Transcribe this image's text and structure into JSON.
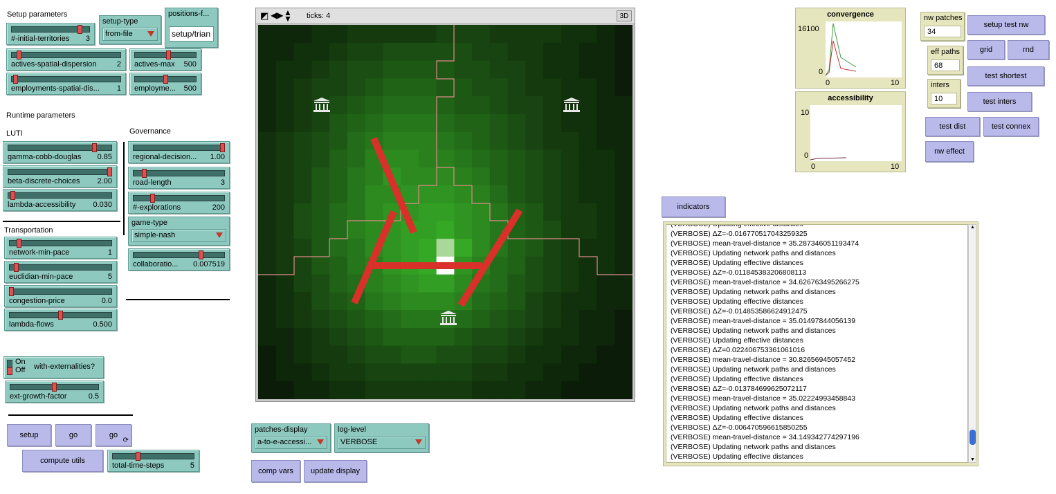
{
  "setup": {
    "section_label": "Setup parameters",
    "initial_territories": {
      "name": "#-initial-territories",
      "value": "3",
      "level": 0.9
    },
    "setup_type": {
      "name": "setup-type",
      "value": "from-file"
    },
    "positions_file": {
      "name": "positions-f...",
      "value": "setup/trian"
    },
    "actives_spatial_dispersion": {
      "name": "actives-spatial-dispersion",
      "value": "2",
      "level": 0.05
    },
    "actives_max": {
      "name": "actives-max",
      "value": "500",
      "level": 0.55
    },
    "employments_spatial_dis": {
      "name": "employments-spatial-dis...",
      "value": "1",
      "level": 0.02
    },
    "employments_max": {
      "name": "employme...",
      "value": "500",
      "level": 0.5
    }
  },
  "runtime": {
    "section_label": "Runtime parameters",
    "luti_label": "LUTI",
    "gamma": {
      "name": "gamma-cobb-douglas",
      "value": "0.85",
      "level": 0.85
    },
    "beta": {
      "name": "beta-discrete-choices",
      "value": "2.00",
      "level": 1.0
    },
    "lambda_access": {
      "name": "lambda-accessibility",
      "value": "0.030",
      "level": 0.03
    },
    "transport_label": "Transportation",
    "network_min_pace": {
      "name": "network-min-pace",
      "value": "1",
      "level": 0.08
    },
    "euclidian_min_pace": {
      "name": "euclidian-min-pace",
      "value": "5",
      "level": 0.05
    },
    "congestion_price": {
      "name": "congestion-price",
      "value": "0.0",
      "level": 0.0
    },
    "lambda_flows": {
      "name": "lambda-flows",
      "value": "0.500",
      "level": 0.5
    },
    "governance_label": "Governance",
    "regional_decision": {
      "name": "regional-decision...",
      "value": "1.00",
      "level": 1.0
    },
    "road_length": {
      "name": "road-length",
      "value": "3",
      "level": 0.1
    },
    "explorations": {
      "name": "#-explorations",
      "value": "200",
      "level": 0.2
    },
    "game_type": {
      "name": "game-type",
      "value": "simple-nash"
    },
    "collaboration": {
      "name": "collaboratio...",
      "value": "0.007519",
      "level": 0.75
    }
  },
  "externalities": {
    "switch_on": "On",
    "switch_off": "Off",
    "switch_name": "with-externalities?",
    "ext_growth": {
      "name": "ext-growth-factor",
      "value": "0.5",
      "level": 0.5
    }
  },
  "controls": {
    "setup": "setup",
    "go_once": "go",
    "go_forever": "go",
    "compute_utils": "compute utils",
    "total_time_steps": {
      "name": "total-time-steps",
      "value": "5",
      "level": 0.3
    }
  },
  "view": {
    "ticks_label": "ticks: 4",
    "three_d": "3D",
    "grid_size": 21,
    "patches": [
      [
        2,
        2,
        2,
        3,
        3,
        4,
        4,
        4,
        4,
        4,
        5,
        5,
        5,
        4,
        4,
        4,
        4,
        3,
        3,
        2,
        1
      ],
      [
        2,
        2,
        3,
        3,
        4,
        5,
        5,
        6,
        6,
        6,
        6,
        6,
        5,
        5,
        4,
        4,
        3,
        3,
        2,
        2,
        1
      ],
      [
        2,
        3,
        3,
        4,
        5,
        6,
        6,
        7,
        7,
        7,
        7,
        6,
        6,
        5,
        5,
        4,
        3,
        3,
        2,
        2,
        1
      ],
      [
        2,
        3,
        4,
        5,
        5,
        6,
        7,
        8,
        8,
        8,
        7,
        7,
        6,
        6,
        5,
        4,
        4,
        3,
        3,
        2,
        1
      ],
      [
        2,
        3,
        4,
        5,
        6,
        7,
        8,
        9,
        9,
        9,
        8,
        7,
        7,
        6,
        5,
        5,
        4,
        3,
        3,
        2,
        2
      ],
      [
        2,
        3,
        4,
        5,
        7,
        8,
        9,
        10,
        10,
        10,
        9,
        8,
        8,
        7,
        6,
        5,
        4,
        3,
        3,
        2,
        2
      ],
      [
        3,
        4,
        5,
        6,
        7,
        9,
        10,
        11,
        11,
        11,
        10,
        9,
        8,
        7,
        6,
        5,
        4,
        4,
        3,
        2,
        2
      ],
      [
        3,
        4,
        5,
        6,
        8,
        9,
        11,
        12,
        12,
        11,
        11,
        10,
        9,
        8,
        7,
        6,
        5,
        4,
        3,
        3,
        2
      ],
      [
        3,
        4,
        5,
        7,
        8,
        10,
        11,
        13,
        12,
        12,
        12,
        11,
        10,
        8,
        7,
        6,
        5,
        4,
        3,
        3,
        2
      ],
      [
        3,
        4,
        5,
        7,
        8,
        10,
        12,
        12,
        13,
        13,
        13,
        12,
        11,
        9,
        7,
        6,
        5,
        4,
        3,
        3,
        2
      ],
      [
        3,
        4,
        6,
        7,
        9,
        10,
        12,
        13,
        13,
        14,
        14,
        13,
        12,
        10,
        8,
        7,
        5,
        4,
        4,
        3,
        2
      ],
      [
        3,
        4,
        6,
        7,
        9,
        11,
        12,
        13,
        14,
        14,
        15,
        13,
        12,
        10,
        8,
        7,
        6,
        4,
        4,
        3,
        2
      ],
      [
        3,
        4,
        5,
        7,
        9,
        10,
        12,
        13,
        14,
        15,
        18,
        15,
        12,
        10,
        8,
        7,
        5,
        4,
        3,
        3,
        2
      ],
      [
        3,
        4,
        5,
        7,
        8,
        10,
        11,
        13,
        14,
        15,
        20,
        13,
        11,
        9,
        8,
        6,
        5,
        4,
        3,
        3,
        2
      ],
      [
        2,
        3,
        5,
        6,
        8,
        9,
        11,
        12,
        13,
        14,
        14,
        12,
        10,
        9,
        7,
        6,
        5,
        4,
        3,
        2,
        2
      ],
      [
        2,
        3,
        4,
        6,
        7,
        8,
        10,
        11,
        12,
        12,
        12,
        11,
        9,
        8,
        7,
        5,
        4,
        3,
        3,
        2,
        2
      ],
      [
        2,
        3,
        4,
        5,
        6,
        7,
        8,
        9,
        10,
        10,
        10,
        9,
        8,
        7,
        6,
        5,
        4,
        3,
        2,
        2,
        1
      ],
      [
        2,
        2,
        3,
        4,
        5,
        6,
        7,
        8,
        8,
        8,
        8,
        7,
        6,
        6,
        5,
        4,
        3,
        3,
        2,
        2,
        1
      ],
      [
        1,
        2,
        3,
        4,
        4,
        5,
        6,
        6,
        7,
        7,
        6,
        6,
        5,
        5,
        4,
        3,
        3,
        2,
        2,
        1,
        1
      ],
      [
        1,
        2,
        2,
        3,
        4,
        4,
        5,
        5,
        5,
        5,
        5,
        5,
        4,
        4,
        3,
        3,
        2,
        2,
        1,
        1,
        1
      ],
      [
        1,
        1,
        2,
        2,
        3,
        3,
        4,
        4,
        4,
        4,
        4,
        4,
        3,
        3,
        3,
        2,
        2,
        1,
        1,
        1,
        1
      ]
    ]
  },
  "bottom_choosers": {
    "patches_display": {
      "name": "patches-display",
      "value": "a-to-e-accessi..."
    },
    "log_level": {
      "name": "log-level",
      "value": "VERBOSE"
    },
    "comp_vars": "comp vars",
    "update_display": "update display"
  },
  "plots": {
    "convergence": {
      "title": "convergence",
      "y_max": "16100",
      "y_min": "0",
      "x_min": "0",
      "x_max": "10"
    },
    "accessibility": {
      "title": "accessibility",
      "y_max": "10",
      "y_min": "0",
      "x_min": "0",
      "x_max": "10"
    }
  },
  "network_panel": {
    "nw_patches": {
      "name": "nw patches",
      "value": "34"
    },
    "eff_paths": {
      "name": "eff paths",
      "value": "68"
    },
    "inters": {
      "name": "inters",
      "value": "10"
    },
    "setup_test_nw": "setup test nw",
    "grid": "grid",
    "rnd": "rnd",
    "test_shortest": "test shortest",
    "test_inters": "test inters",
    "test_dist": "test dist",
    "test_connex": "test connex",
    "nw_effect": "nw effect"
  },
  "indicators_button": "indicators",
  "output": {
    "lines": [
      "(VERBOSE) Updating effective distances",
      "(VERBOSE) ΔZ=-0.016770517043259325",
      "(VERBOSE) mean-travel-distance = 35.287346051193474",
      "(VERBOSE) Updating network paths and distances",
      "(VERBOSE) Updating effective distances",
      "(VERBOSE) ΔZ=-0.011845383206808113",
      "(VERBOSE) mean-travel-distance = 34.626763495266275",
      "(VERBOSE) Updating network paths and distances",
      "(VERBOSE) Updating effective distances",
      "(VERBOSE) ΔZ=-0.014853586624912475",
      "(VERBOSE) mean-travel-distance = 35.01497844056139",
      "(VERBOSE) Updating network paths and distances",
      "(VERBOSE) Updating effective distances",
      "(VERBOSE) ΔZ=0.022406753361061016",
      "(VERBOSE) mean-travel-distance = 30.82656945057452",
      "(VERBOSE) Updating network paths and distances",
      "(VERBOSE) Updating effective distances",
      "(VERBOSE) ΔZ=-0.013784699625072117",
      "(VERBOSE) mean-travel-distance = 35.02224993458843",
      "(VERBOSE) Updating network paths and distances",
      "(VERBOSE) Updating effective distances",
      "(VERBOSE) ΔZ=-0.006470596615850255",
      "(VERBOSE) mean-travel-distance = 34.149342774297196",
      "(VERBOSE) Updating network paths and distances",
      "(VERBOSE) Updating effective distances"
    ]
  },
  "colors": {
    "slider_bg": "#8ec9c0",
    "button_bg": "#b9b9ea",
    "monitor_bg": "#e6e6be",
    "road_red": "#d9302a",
    "boundary_pink": "#e08a8a"
  }
}
